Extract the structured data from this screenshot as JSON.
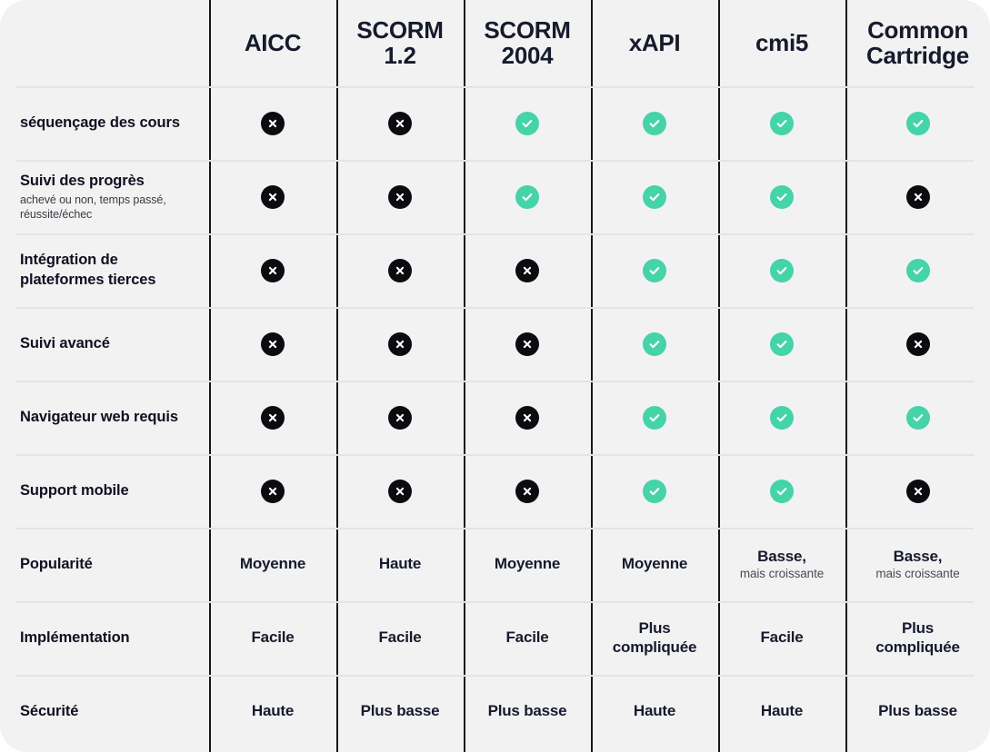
{
  "table": {
    "columns": [
      {
        "key": "feature",
        "label": ""
      },
      {
        "key": "aicc",
        "label": "AICC"
      },
      {
        "key": "scorm12",
        "label": "SCORM 1.2"
      },
      {
        "key": "scorm2004",
        "label": "SCORM\n2004"
      },
      {
        "key": "xapi",
        "label": "xAPI"
      },
      {
        "key": "cmi5",
        "label": "cmi5"
      },
      {
        "key": "commoncartridge",
        "label": "Common\nCartridge"
      }
    ],
    "rows": [
      {
        "title": "séquençage des cours",
        "subtitle": "",
        "values": [
          {
            "type": "icon",
            "icon": "cross-icon",
            "state": "no"
          },
          {
            "type": "icon",
            "icon": "cross-icon",
            "state": "no"
          },
          {
            "type": "icon",
            "icon": "check-icon",
            "state": "yes"
          },
          {
            "type": "icon",
            "icon": "check-icon",
            "state": "yes"
          },
          {
            "type": "icon",
            "icon": "check-icon",
            "state": "yes"
          },
          {
            "type": "icon",
            "icon": "check-icon",
            "state": "yes"
          }
        ]
      },
      {
        "title": "Suivi des progrès",
        "subtitle": "achevé ou non, temps passé, réussite/échec",
        "values": [
          {
            "type": "icon",
            "icon": "cross-icon",
            "state": "no"
          },
          {
            "type": "icon",
            "icon": "cross-icon",
            "state": "no"
          },
          {
            "type": "icon",
            "icon": "check-icon",
            "state": "yes"
          },
          {
            "type": "icon",
            "icon": "check-icon",
            "state": "yes"
          },
          {
            "type": "icon",
            "icon": "check-icon",
            "state": "yes"
          },
          {
            "type": "icon",
            "icon": "cross-icon",
            "state": "no"
          }
        ]
      },
      {
        "title": "Intégration de plateformes tierces",
        "subtitle": "",
        "values": [
          {
            "type": "icon",
            "icon": "cross-icon",
            "state": "no"
          },
          {
            "type": "icon",
            "icon": "cross-icon",
            "state": "no"
          },
          {
            "type": "icon",
            "icon": "cross-icon",
            "state": "no"
          },
          {
            "type": "icon",
            "icon": "check-icon",
            "state": "yes"
          },
          {
            "type": "icon",
            "icon": "check-icon",
            "state": "yes"
          },
          {
            "type": "icon",
            "icon": "check-icon",
            "state": "yes"
          }
        ]
      },
      {
        "title": "Suivi avancé",
        "subtitle": "",
        "values": [
          {
            "type": "icon",
            "icon": "cross-icon",
            "state": "no"
          },
          {
            "type": "icon",
            "icon": "cross-icon",
            "state": "no"
          },
          {
            "type": "icon",
            "icon": "cross-icon",
            "state": "no"
          },
          {
            "type": "icon",
            "icon": "check-icon",
            "state": "yes"
          },
          {
            "type": "icon",
            "icon": "check-icon",
            "state": "yes"
          },
          {
            "type": "icon",
            "icon": "cross-icon",
            "state": "no"
          }
        ]
      },
      {
        "title": "Navigateur web requis",
        "subtitle": "",
        "values": [
          {
            "type": "icon",
            "icon": "cross-icon",
            "state": "no"
          },
          {
            "type": "icon",
            "icon": "cross-icon",
            "state": "no"
          },
          {
            "type": "icon",
            "icon": "cross-icon",
            "state": "no"
          },
          {
            "type": "icon",
            "icon": "check-icon",
            "state": "yes"
          },
          {
            "type": "icon",
            "icon": "check-icon",
            "state": "yes"
          },
          {
            "type": "icon",
            "icon": "check-icon",
            "state": "yes"
          }
        ]
      },
      {
        "title": "Support mobile",
        "subtitle": "",
        "values": [
          {
            "type": "icon",
            "icon": "cross-icon",
            "state": "no"
          },
          {
            "type": "icon",
            "icon": "cross-icon",
            "state": "no"
          },
          {
            "type": "icon",
            "icon": "cross-icon",
            "state": "no"
          },
          {
            "type": "icon",
            "icon": "check-icon",
            "state": "yes"
          },
          {
            "type": "icon",
            "icon": "check-icon",
            "state": "yes"
          },
          {
            "type": "icon",
            "icon": "cross-icon",
            "state": "no"
          }
        ]
      },
      {
        "title": "Popularité",
        "subtitle": "",
        "values": [
          {
            "type": "text",
            "text": "Moyenne",
            "sub": ""
          },
          {
            "type": "text",
            "text": "Haute",
            "sub": ""
          },
          {
            "type": "text",
            "text": "Moyenne",
            "sub": ""
          },
          {
            "type": "text",
            "text": "Moyenne",
            "sub": ""
          },
          {
            "type": "text",
            "text": "Basse,",
            "sub": "mais croissante"
          },
          {
            "type": "text",
            "text": "Basse,",
            "sub": "mais croissante"
          }
        ]
      },
      {
        "title": "Implémentation",
        "subtitle": "",
        "values": [
          {
            "type": "text",
            "text": "Facile",
            "sub": ""
          },
          {
            "type": "text",
            "text": "Facile",
            "sub": ""
          },
          {
            "type": "text",
            "text": "Facile",
            "sub": ""
          },
          {
            "type": "text",
            "text": "Plus compliquée",
            "sub": ""
          },
          {
            "type": "text",
            "text": "Facile",
            "sub": ""
          },
          {
            "type": "text",
            "text": "Plus compliquée",
            "sub": ""
          }
        ]
      },
      {
        "title": "Sécurité",
        "subtitle": "",
        "values": [
          {
            "type": "text",
            "text": "Haute",
            "sub": ""
          },
          {
            "type": "text",
            "text": "Plus basse",
            "sub": ""
          },
          {
            "type": "text",
            "text": "Plus basse",
            "sub": ""
          },
          {
            "type": "text",
            "text": "Haute",
            "sub": ""
          },
          {
            "type": "text",
            "text": "Haute",
            "sub": ""
          },
          {
            "type": "text",
            "text": "Plus basse",
            "sub": ""
          }
        ]
      }
    ]
  },
  "colors": {
    "background": "#f2f2f3",
    "yes": "#45d3a8",
    "no": "#0b0b10",
    "text": "#161a2c",
    "divider_vertical": "#16161f",
    "divider_horizontal": "#e4e4e6"
  }
}
